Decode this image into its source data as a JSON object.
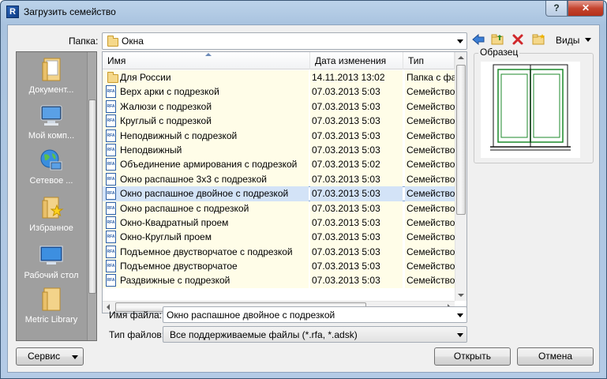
{
  "window": {
    "title": "Загрузить семейство",
    "help_label": "?",
    "close_label": "✕"
  },
  "toolbar": {
    "folder_label": "Папка:",
    "folder_value": "Окна",
    "views_label": "Виды"
  },
  "places": [
    {
      "label": "Документ...",
      "icon": "documents-icon"
    },
    {
      "label": "Мой комп...",
      "icon": "computer-icon"
    },
    {
      "label": "Сетевое ...",
      "icon": "network-icon"
    },
    {
      "label": "Избранное",
      "icon": "favorites-icon"
    },
    {
      "label": "Рабочий стол",
      "icon": "desktop-icon"
    },
    {
      "label": "Metric Library",
      "icon": "library-folder-icon"
    }
  ],
  "file_list": {
    "columns": [
      "Имя",
      "Дата изменения",
      "Тип"
    ],
    "rows": [
      {
        "name": "Для России",
        "date": "14.11.2013 13:02",
        "type": "Папка с фа",
        "kind": "folder"
      },
      {
        "name": "Верх арки с подрезкой",
        "date": "07.03.2013 5:03",
        "type": "Семейство",
        "kind": "rfa"
      },
      {
        "name": "Жалюзи с подрезкой",
        "date": "07.03.2013 5:03",
        "type": "Семейство",
        "kind": "rfa"
      },
      {
        "name": "Круглый с подрезкой",
        "date": "07.03.2013 5:03",
        "type": "Семейство",
        "kind": "rfa"
      },
      {
        "name": "Неподвижный с подрезкой",
        "date": "07.03.2013 5:03",
        "type": "Семейство",
        "kind": "rfa"
      },
      {
        "name": "Неподвижный",
        "date": "07.03.2013 5:03",
        "type": "Семейство",
        "kind": "rfa"
      },
      {
        "name": "Объединение армирования с подрезкой",
        "date": "07.03.2013 5:02",
        "type": "Семейство",
        "kind": "rfa"
      },
      {
        "name": "Окно распашное 3х3 с подрезкой",
        "date": "07.03.2013 5:03",
        "type": "Семейство",
        "kind": "rfa"
      },
      {
        "name": "Окно распашное двойное с подрезкой",
        "date": "07.03.2013 5:03",
        "type": "Семейство",
        "kind": "rfa",
        "selected": true
      },
      {
        "name": "Окно распашное с подрезкой",
        "date": "07.03.2013 5:03",
        "type": "Семейство",
        "kind": "rfa"
      },
      {
        "name": "Окно-Квадратный проем",
        "date": "07.03.2013 5:03",
        "type": "Семейство",
        "kind": "rfa"
      },
      {
        "name": "Окно-Круглый проем",
        "date": "07.03.2013 5:03",
        "type": "Семейство",
        "kind": "rfa"
      },
      {
        "name": "Подъемное двустворчатое с подрезкой",
        "date": "07.03.2013 5:03",
        "type": "Семейство",
        "kind": "rfa"
      },
      {
        "name": "Подъемное двустворчатое",
        "date": "07.03.2013 5:03",
        "type": "Семейство",
        "kind": "rfa"
      },
      {
        "name": "Раздвижные с подрезкой",
        "date": "07.03.2013 5:03",
        "type": "Семейство",
        "kind": "rfa"
      }
    ]
  },
  "preview": {
    "label": "Образец"
  },
  "filename": {
    "label": "Имя файла:",
    "value": "Окно распашное двойное с подрезкой"
  },
  "filetype": {
    "label": "Тип файлов:",
    "value": "Все поддерживаемые файлы  (*.rfa, *.adsk)"
  },
  "buttons": {
    "service": "Сервис",
    "open": "Открыть",
    "cancel": "Отмена"
  },
  "colors": {
    "title_gradient": "#a9c3df",
    "close_red": "#c5452f",
    "row_bg": "#fffde8",
    "selected_row": "#d3e3f7",
    "places_bg": "#9f9f9f"
  }
}
